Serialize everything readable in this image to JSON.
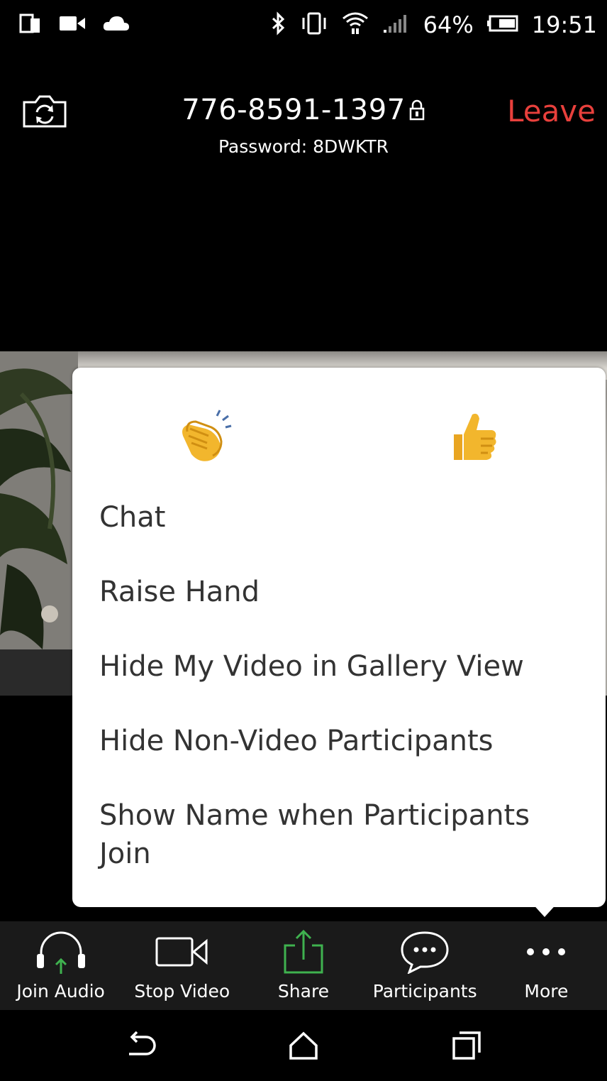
{
  "status_bar": {
    "battery_percent": "64%",
    "time": "19:51",
    "icons": [
      "screen-mirror-icon",
      "video-camera-icon",
      "cloud-icon",
      "bluetooth-icon",
      "vibrate-icon",
      "wifi-icon",
      "signal-icon",
      "battery-icon"
    ]
  },
  "header": {
    "meeting_id": "776-8591-1397",
    "password": "Password: 8DWKTR",
    "leave_label": "Leave"
  },
  "more_menu": {
    "reactions": [
      "clapping-hands-icon",
      "thumbs-up-icon"
    ],
    "items": [
      {
        "label": "Chat"
      },
      {
        "label": "Raise Hand"
      },
      {
        "label": "Hide My Video in Gallery View"
      },
      {
        "label": "Hide Non-Video Participants"
      },
      {
        "label": "Show Name when Participants Join"
      }
    ]
  },
  "toolbar": {
    "items": [
      {
        "label": "Join Audio",
        "icon": "headphones-icon"
      },
      {
        "label": "Stop Video",
        "icon": "video-camera-icon"
      },
      {
        "label": "Share",
        "icon": "share-upload-icon"
      },
      {
        "label": "Participants",
        "icon": "chat-bubble-icon"
      },
      {
        "label": "More",
        "icon": "more-dots-icon"
      }
    ]
  },
  "colors": {
    "leave": "#e8403c",
    "share_green": "#3fb24f",
    "join_audio_arrow": "#3fb24f",
    "menu_text": "#333333",
    "toolbar_bg": "#1a1a1a"
  }
}
